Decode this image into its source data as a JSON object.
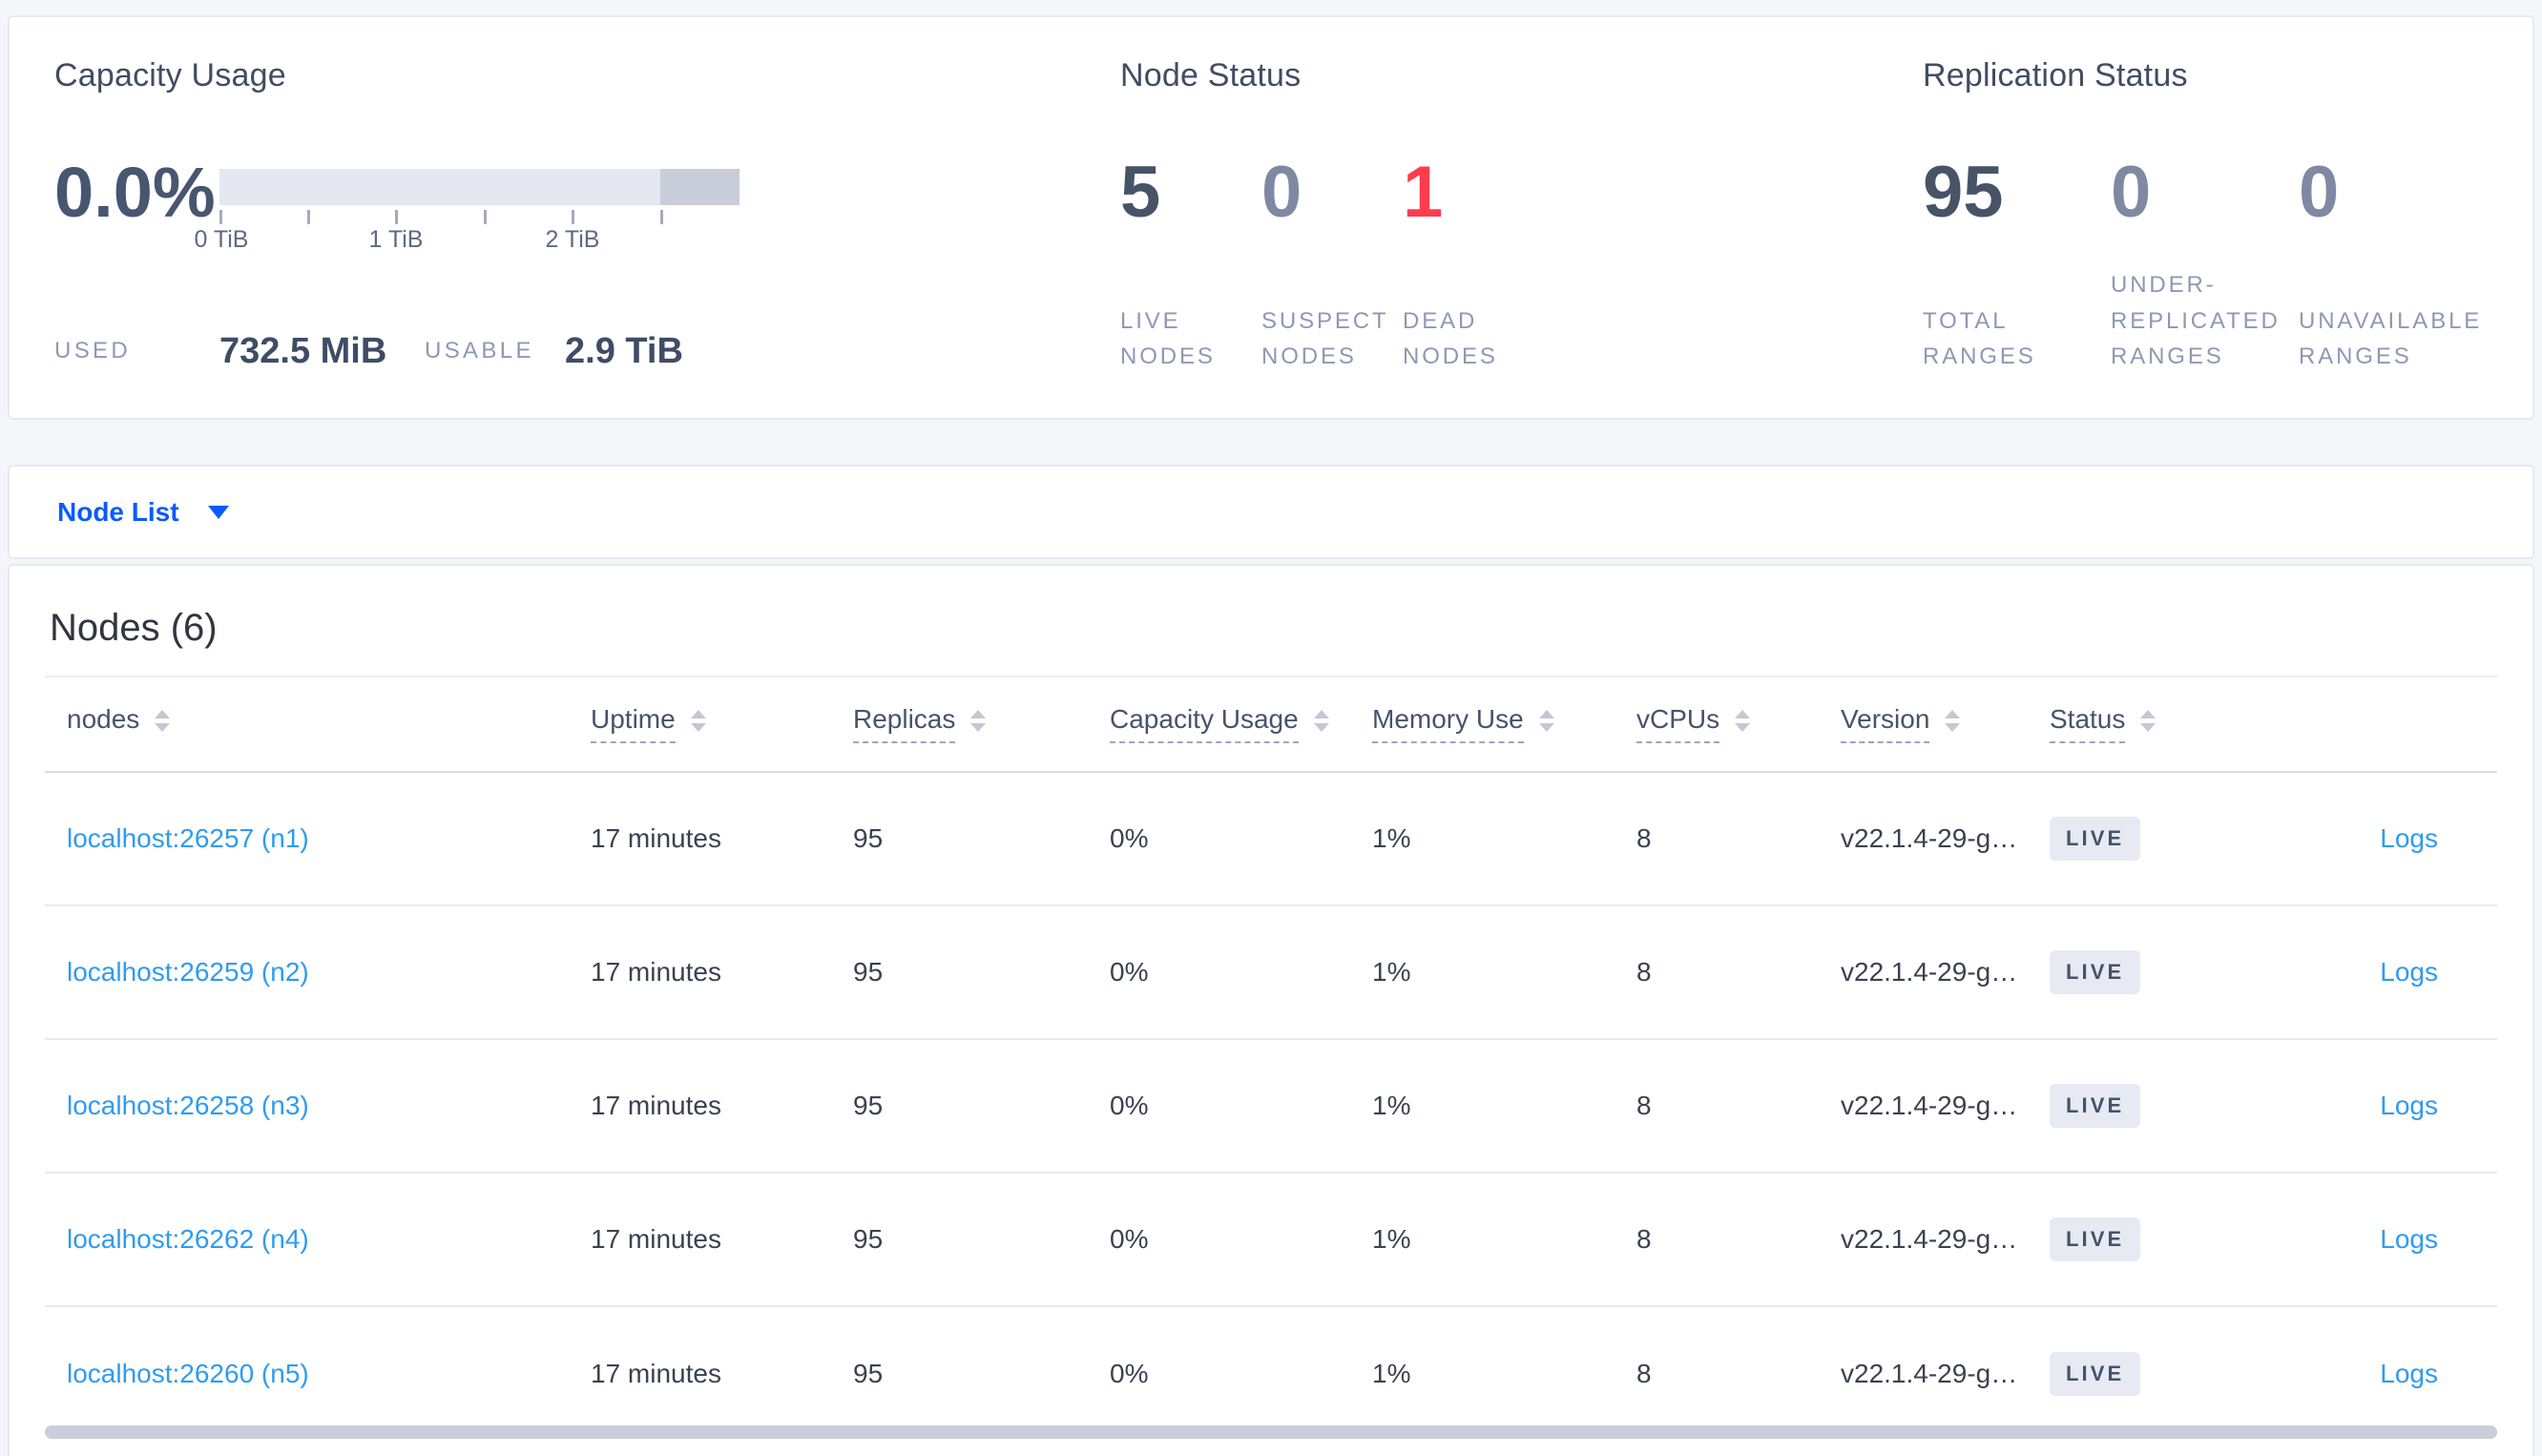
{
  "summary": {
    "capacity": {
      "title": "Capacity Usage",
      "percent": "0.0%",
      "tick_labels": [
        "0 TiB",
        "1 TiB",
        "2 TiB"
      ],
      "used_label": "USED",
      "used_value": "732.5 MiB",
      "usable_label": "USABLE",
      "usable_value": "2.9 TiB"
    },
    "node_status": {
      "title": "Node Status",
      "metrics": [
        {
          "value": "5",
          "label": "LIVE NODES",
          "style": "primary"
        },
        {
          "value": "0",
          "label": "SUSPECT NODES",
          "style": "muted"
        },
        {
          "value": "1",
          "label": "DEAD NODES",
          "style": "danger"
        }
      ]
    },
    "replication": {
      "title": "Replication Status",
      "metrics": [
        {
          "value": "95",
          "label": "TOTAL RANGES",
          "style": "primary"
        },
        {
          "value": "0",
          "label": "UNDER-REPLICATED RANGES",
          "style": "muted"
        },
        {
          "value": "0",
          "label": "UNAVAILABLE RANGES",
          "style": "muted"
        }
      ]
    }
  },
  "view_selector": {
    "label": "Node List"
  },
  "nodes_section": {
    "heading": "Nodes (6)",
    "columns": [
      {
        "label": "nodes",
        "underline": "false"
      },
      {
        "label": "Uptime",
        "underline": "true"
      },
      {
        "label": "Replicas",
        "underline": "true"
      },
      {
        "label": "Capacity Usage",
        "underline": "true"
      },
      {
        "label": "Memory Use",
        "underline": "true"
      },
      {
        "label": "vCPUs",
        "underline": "true"
      },
      {
        "label": "Version",
        "underline": "true"
      },
      {
        "label": "Status",
        "underline": "true"
      }
    ],
    "rows": [
      {
        "node": "localhost:26257 (n1)",
        "uptime": "17 minutes",
        "replicas": "95",
        "capacity": "0%",
        "memory": "1%",
        "vcpus": "8",
        "version": "v22.1.4-29-g…",
        "status": "LIVE",
        "logs": "Logs"
      },
      {
        "node": "localhost:26259 (n2)",
        "uptime": "17 minutes",
        "replicas": "95",
        "capacity": "0%",
        "memory": "1%",
        "vcpus": "8",
        "version": "v22.1.4-29-g…",
        "status": "LIVE",
        "logs": "Logs"
      },
      {
        "node": "localhost:26258 (n3)",
        "uptime": "17 minutes",
        "replicas": "95",
        "capacity": "0%",
        "memory": "1%",
        "vcpus": "8",
        "version": "v22.1.4-29-g…",
        "status": "LIVE",
        "logs": "Logs"
      },
      {
        "node": "localhost:26262 (n4)",
        "uptime": "17 minutes",
        "replicas": "95",
        "capacity": "0%",
        "memory": "1%",
        "vcpus": "8",
        "version": "v22.1.4-29-g…",
        "status": "LIVE",
        "logs": "Logs"
      },
      {
        "node": "localhost:26260 (n5)",
        "uptime": "17 minutes",
        "replicas": "95",
        "capacity": "0%",
        "memory": "1%",
        "vcpus": "8",
        "version": "v22.1.4-29-g…",
        "status": "LIVE",
        "logs": "Logs"
      }
    ]
  },
  "colors": {
    "accent_blue": "#0a5aff",
    "link_blue": "#2f9bf2",
    "danger_red": "#fc3d4e",
    "stat_primary": "#475468",
    "stat_muted": "#8089a3",
    "badge_bg": "#e7eaf2",
    "bar_light": "#e6e8f1",
    "bar_dark": "#c9cdda",
    "page_bg": "#f4f6fa"
  }
}
